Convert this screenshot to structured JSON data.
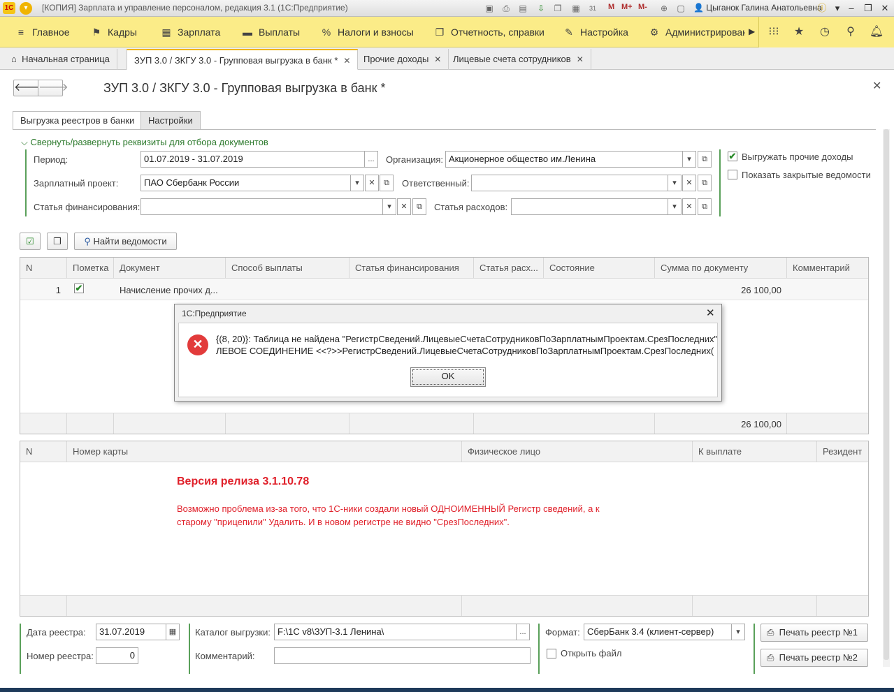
{
  "window": {
    "logo": "1С",
    "title": "[КОПИЯ] Зарплата и управление персоналом, редакция 3.1  (1С:Предприятие)",
    "m_labels": [
      "M",
      "M+",
      "M-"
    ],
    "user": "Цыганок Галина Анатольевна",
    "calendar_day": "31"
  },
  "main_menu": {
    "items": [
      {
        "icon": "≡",
        "label": "Главное"
      },
      {
        "icon": "⚑",
        "label": "Кадры"
      },
      {
        "icon": "▦",
        "label": "Зарплата"
      },
      {
        "icon": "▬",
        "label": "Выплаты"
      },
      {
        "icon": "%",
        "label": "Налоги и взносы"
      },
      {
        "icon": "❐",
        "label": "Отчетность, справки"
      },
      {
        "icon": "✎",
        "label": "Настройка"
      },
      {
        "icon": "⚙",
        "label": "Администрирован"
      }
    ]
  },
  "tabs": [
    {
      "label": "Начальная страница"
    },
    {
      "label": "ЗУП 3.0 / ЗКГУ 3.0 - Групповая выгрузка в банк *"
    },
    {
      "label": "Прочие доходы"
    },
    {
      "label": "Лицевые счета сотрудников"
    }
  ],
  "form": {
    "title": "ЗУП 3.0 / ЗКГУ 3.0 - Групповая выгрузка в банк *",
    "inner_tabs": [
      "Выгрузка реестров в банки",
      "Настройки"
    ],
    "collapse_label": "Свернуть/развернуть реквизиты для отбора документов",
    "filters": {
      "period_label": "Период:",
      "period_value": "01.07.2019 - 31.07.2019",
      "org_label": "Организация:",
      "org_value": "Акционерное общество им.Ленина",
      "project_label": "Зарплатный проект:",
      "project_value": "ПАО Сбербанк России",
      "resp_label": "Ответственный:",
      "resp_value": "",
      "fin_label": "Статья финансирования:",
      "fin_value": "",
      "exp_label": "Статья расходов:",
      "exp_value": ""
    },
    "checks": {
      "other_income_label": "Выгружать прочие доходы",
      "other_income_checked": true,
      "closed_label": "Показать закрытые ведомости",
      "closed_checked": false
    },
    "toolbar": {
      "find_label": "Найти ведомости"
    }
  },
  "docs_table": {
    "headers": [
      "N",
      "Пометка",
      "Документ",
      "Способ выплаты",
      "Статья финансирования",
      "Статья расх...",
      "Состояние",
      "Сумма по документу",
      "Комментарий"
    ],
    "rows": [
      {
        "n": "1",
        "mark": "✔",
        "doc": "Начисление прочих д...",
        "sum": "26 100,00"
      }
    ],
    "total": "26 100,00"
  },
  "dialog": {
    "title": "1С:Предприятие",
    "line1": "{(8, 20)}: Таблица не найдена \"РегистрСведений.ЛицевыеСчетаСотрудниковПоЗарплатнымПроектам.СрезПоследних\"",
    "line2": "ЛЕВОЕ СОЕДИНЕНИЕ <<?>>РегистрСведений.ЛицевыеСчетаСотрудниковПоЗарплатнымПроектам.СрезПоследних(",
    "ok_label": "OK"
  },
  "cards_table": {
    "headers": [
      "N",
      "Номер карты",
      "Физическое лицо",
      "К выплате",
      "Резидент"
    ]
  },
  "annotation": {
    "title": "Версия релиза 3.1.10.78",
    "text": "Возможно проблема из-за того, что 1С-ники создали новый ОДНОИМЕННЫЙ Регистр сведений, а к старому \"прицепили\" Удалить. И в новом регистре не видно \"СрезПоследних\"."
  },
  "bottom": {
    "date_label": "Дата реестра:",
    "date_value": "31.07.2019",
    "num_label": "Номер реестра:",
    "num_value": "0",
    "catalog_label": "Каталог выгрузки:",
    "catalog_value": "F:\\1С v8\\ЗУП-3.1 Ленина\\",
    "comment_label": "Комментарий:",
    "comment_value": "",
    "format_label": "Формат:",
    "format_value": "СберБанк 3.4 (клиент-сервер)",
    "open_file_label": "Открыть файл",
    "print1_label": "Печать реестр №1",
    "print2_label": "Печать реестр №2"
  },
  "colors": {
    "menu_bg": "#fbec88",
    "accent_green": "#2d7a2d",
    "annotation_red": "#e0202a",
    "error_red": "#e23b3b"
  }
}
